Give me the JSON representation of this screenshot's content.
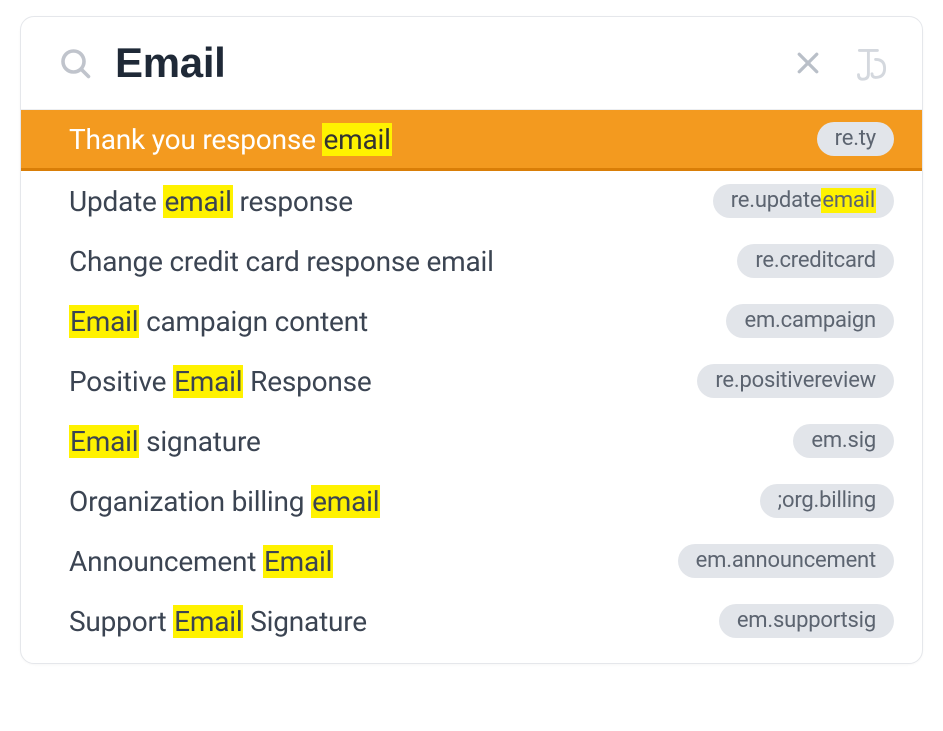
{
  "colors": {
    "highlight": "#fff200",
    "selected_bg": "#f39a1f",
    "selected_underline": "#d97e07",
    "text": "#3b4452",
    "tag_bg": "#e2e5ea",
    "tag_text": "#5c6470"
  },
  "search": {
    "value": "Email",
    "placeholder": "Search"
  },
  "results": [
    {
      "label_parts": [
        {
          "t": "Thank you response ",
          "hl": false
        },
        {
          "t": "email",
          "hl": true
        }
      ],
      "tag_parts": [
        {
          "t": "re.ty",
          "hl": false
        }
      ],
      "selected": true
    },
    {
      "label_parts": [
        {
          "t": "Update ",
          "hl": false
        },
        {
          "t": "email",
          "hl": true
        },
        {
          "t": " response",
          "hl": false
        }
      ],
      "tag_parts": [
        {
          "t": "re.update",
          "hl": false
        },
        {
          "t": "email",
          "hl": true
        }
      ],
      "selected": false
    },
    {
      "label_parts": [
        {
          "t": "Change credit card response email",
          "hl": false
        }
      ],
      "tag_parts": [
        {
          "t": "re.creditcard",
          "hl": false
        }
      ],
      "selected": false
    },
    {
      "label_parts": [
        {
          "t": "Email",
          "hl": true
        },
        {
          "t": " campaign content",
          "hl": false
        }
      ],
      "tag_parts": [
        {
          "t": "em.campaign",
          "hl": false
        }
      ],
      "selected": false
    },
    {
      "label_parts": [
        {
          "t": "Positive ",
          "hl": false
        },
        {
          "t": "Email",
          "hl": true
        },
        {
          "t": " Response",
          "hl": false
        }
      ],
      "tag_parts": [
        {
          "t": "re.positivereview",
          "hl": false
        }
      ],
      "selected": false
    },
    {
      "label_parts": [
        {
          "t": "Email",
          "hl": true
        },
        {
          "t": " signature",
          "hl": false
        }
      ],
      "tag_parts": [
        {
          "t": "em.sig",
          "hl": false
        }
      ],
      "selected": false
    },
    {
      "label_parts": [
        {
          "t": "Organization billing ",
          "hl": false
        },
        {
          "t": "email",
          "hl": true
        }
      ],
      "tag_parts": [
        {
          "t": ";org.billing",
          "hl": false
        }
      ],
      "selected": false
    },
    {
      "label_parts": [
        {
          "t": "Announcement ",
          "hl": false
        },
        {
          "t": "Email",
          "hl": true
        }
      ],
      "tag_parts": [
        {
          "t": "em.announcement",
          "hl": false
        }
      ],
      "selected": false
    },
    {
      "label_parts": [
        {
          "t": "Support ",
          "hl": false
        },
        {
          "t": "Email",
          "hl": true
        },
        {
          "t": " Signature",
          "hl": false
        }
      ],
      "tag_parts": [
        {
          "t": "em.supportsig",
          "hl": false
        }
      ],
      "selected": false
    }
  ]
}
